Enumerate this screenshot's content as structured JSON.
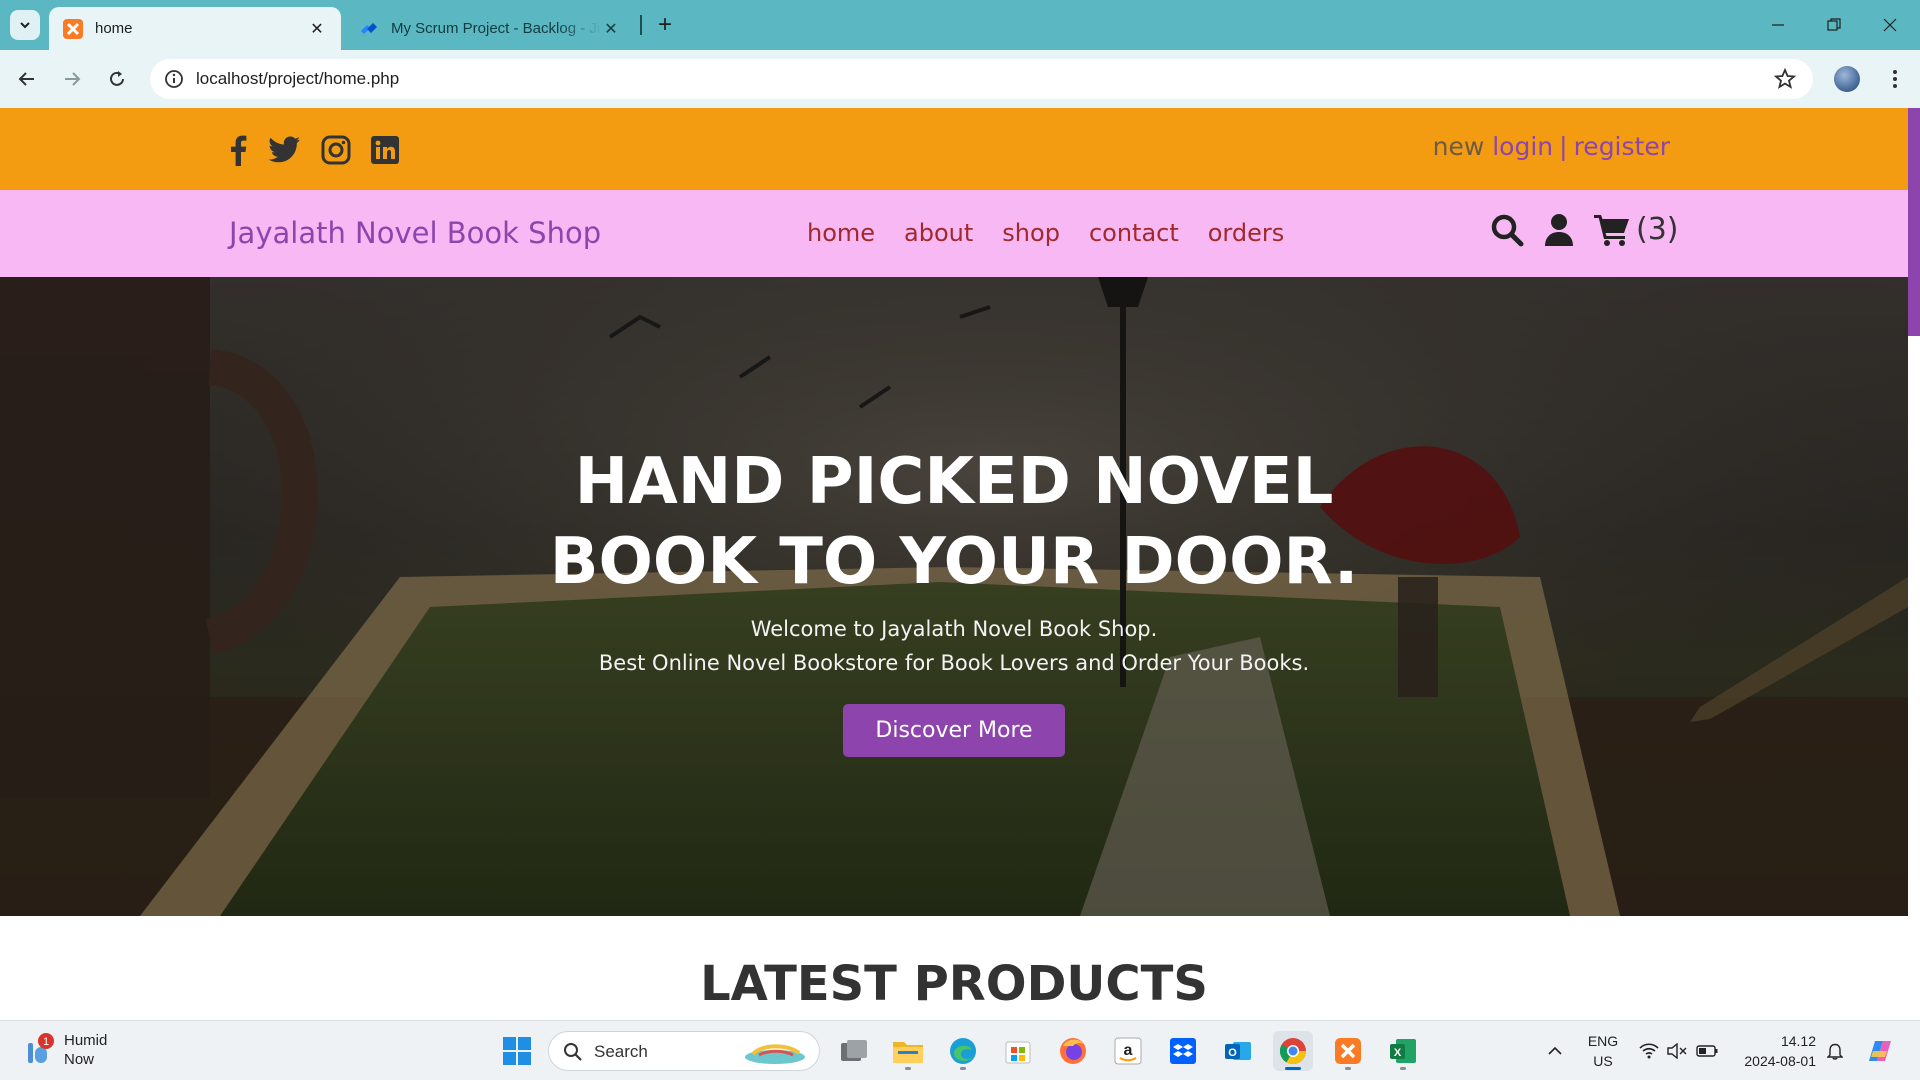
{
  "browser": {
    "tabs": [
      {
        "title": "home",
        "active": true
      },
      {
        "title": "My Scrum Project - Backlog - Jira",
        "active": false
      }
    ],
    "url": "localhost/project/home.php"
  },
  "site": {
    "auth": {
      "new_label": "new",
      "login_label": "login",
      "separator": "|",
      "register_label": "register"
    },
    "social_icons": [
      "facebook-icon",
      "twitter-icon",
      "instagram-icon",
      "linkedin-icon"
    ],
    "logo": "Jayalath Novel Book Shop",
    "nav": [
      "home",
      "about",
      "shop",
      "contact",
      "orders"
    ],
    "cart_count": "(3)",
    "colors": {
      "top_bar": "#f39c12",
      "nav_bar": "#f8b8f3",
      "accent": "#8e44ad",
      "nav_link": "#a0292c"
    }
  },
  "hero": {
    "title_line1": "HAND PICKED NOVEL",
    "title_line2": "BOOK TO YOUR DOOR.",
    "subtitle_line1": "Welcome to Jayalath Novel Book Shop.",
    "subtitle_line2": "Best Online Novel Bookstore for Book Lovers and Order Your Books.",
    "button": "Discover More"
  },
  "latest_title": "LATEST PRODUCTS",
  "taskbar": {
    "weather": {
      "title": "Humid",
      "sub": "Now",
      "badge": "1"
    },
    "search_label": "Search",
    "language": {
      "line1": "ENG",
      "line2": "US"
    },
    "time": "14.12",
    "date": "2024-08-01"
  }
}
